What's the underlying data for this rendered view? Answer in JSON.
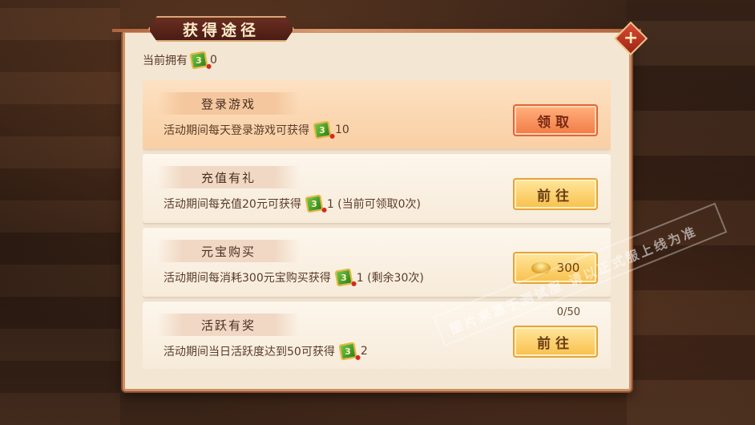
{
  "dialog": {
    "title": "获得途径",
    "owned_label": "当前拥有",
    "owned_count": "0"
  },
  "rows": [
    {
      "name": "登录游戏",
      "desc": "活动期间每天登录游戏可获得",
      "reward": "10",
      "button": "领取",
      "highlight": true
    },
    {
      "name": "充值有礼",
      "desc": "活动期间每充值20元可获得",
      "reward": "1 (当前可领取0次)",
      "button": "前往"
    },
    {
      "name": "元宝购买",
      "desc": "活动期间每消耗300元宝购买获得",
      "reward": "1 (剩余30次)",
      "button": "300"
    },
    {
      "name": "活跃有奖",
      "desc": "活动期间当日活跃度达到50可获得",
      "reward": "2",
      "button": "前往",
      "progress": "0/50"
    }
  ],
  "watermark": "图片来源于测试服 请以正式服上线为准",
  "icons": {
    "ticket": "green-ticket-icon",
    "ingot": "gold-ingot-icon",
    "close": "close-icon"
  },
  "colors": {
    "panel": "#f3e6d3",
    "highlight_row": "#fde1c2",
    "claim_button": "#f27a45",
    "go_button": "#f8c04c",
    "title_plate": "#4a1c14"
  }
}
